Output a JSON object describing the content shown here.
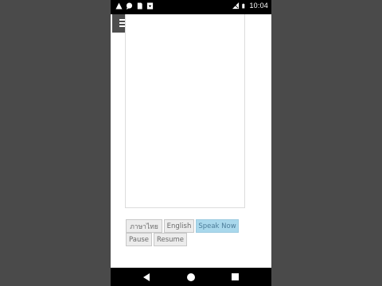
{
  "status_bar": {
    "time": "10:04",
    "left_icons": [
      "alert-triangle-icon",
      "chat-bubble-icon",
      "sim-card-icon",
      "download-icon"
    ],
    "right_icons": [
      "signal-wifi-icon",
      "battery-icon"
    ]
  },
  "menu": {
    "icon": "hamburger-menu-icon"
  },
  "buttons": {
    "thai": "ภาษาไทย",
    "english": "English",
    "speak_now": "Speak Now",
    "pause": "Pause",
    "resume": "Resume"
  },
  "colors": {
    "speak_now_bg": "#a9d8ec",
    "menu_bg": "#4d4d4d",
    "outer_bg": "#4a4a4a"
  },
  "nav_bar": {
    "icons": [
      "back-icon",
      "home-icon",
      "recent-apps-icon"
    ]
  }
}
